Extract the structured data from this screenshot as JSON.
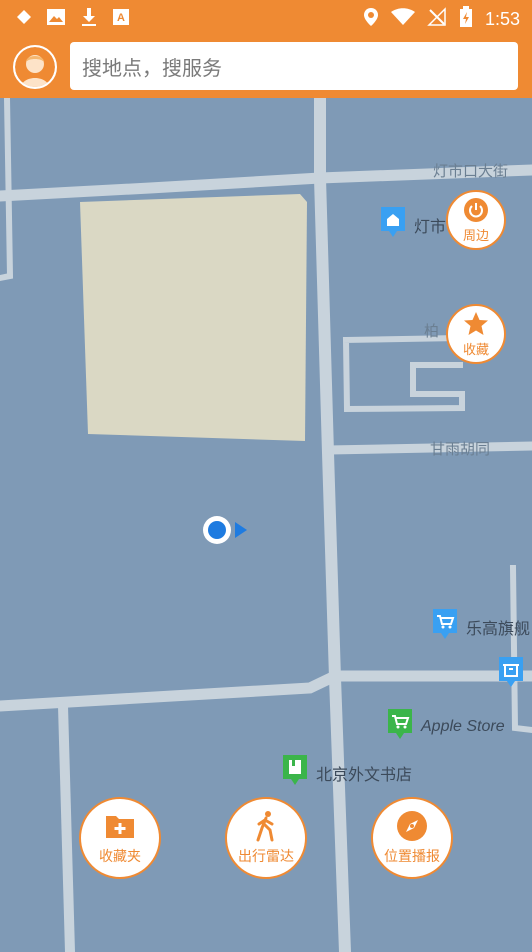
{
  "status_bar": {
    "time": "1:53",
    "icons": [
      "diamond-icon",
      "image-icon",
      "download-icon",
      "keyboard-a-icon",
      "location-icon",
      "wifi-icon",
      "no-signal-icon",
      "battery-charging-icon"
    ]
  },
  "header": {
    "search_placeholder": "搜地点，搜服务",
    "avatar": "user-avatar"
  },
  "map": {
    "road_labels": [
      "灯市口大街",
      "柏",
      "甘雨胡同"
    ],
    "pois": [
      {
        "name": "灯市",
        "icon": "building-icon",
        "color": "#39a0f2"
      },
      {
        "name": "乐高旗舰",
        "icon": "cart-icon",
        "color": "#39a0f2"
      },
      {
        "name": "Apple Store",
        "icon": "cart-icon",
        "color": "#3bb54a"
      },
      {
        "name": "北京外文书店",
        "icon": "book-icon",
        "color": "#3bb54a"
      },
      {
        "name": "",
        "icon": "shop-icon",
        "color": "#39a0f2"
      }
    ]
  },
  "side_buttons": [
    {
      "label": "周边",
      "icon": "power-icon"
    },
    {
      "label": "收藏",
      "icon": "star-icon"
    }
  ],
  "bottom_buttons": [
    {
      "label": "收藏夹",
      "icon": "folder-plus-icon"
    },
    {
      "label": "出行雷达",
      "icon": "walk-icon"
    },
    {
      "label": "位置播报",
      "icon": "compass-icon"
    }
  ],
  "colors": {
    "accent": "#ef8a33",
    "map_bg": "#7f9ab6",
    "road": "#c8d3dc",
    "block": "#dad8c4"
  }
}
